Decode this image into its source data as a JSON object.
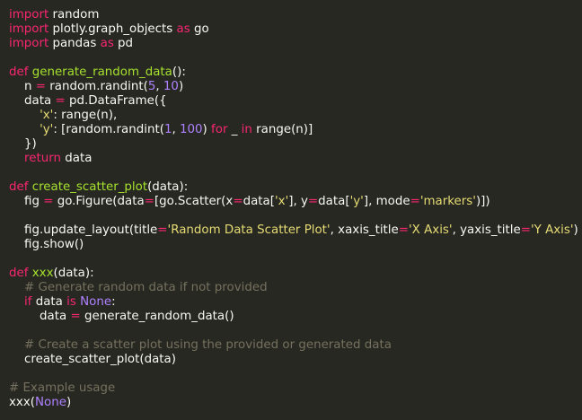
{
  "theme": {
    "background": "#272822",
    "text": "#f8f8f2",
    "keyword": "#f92672",
    "function": "#a6e22e",
    "string": "#e6db74",
    "number": "#ae81ff",
    "comment": "#75715e"
  },
  "code": {
    "lines": [
      [
        {
          "t": "kw",
          "s": "import"
        },
        {
          "t": "txt",
          "s": " random"
        }
      ],
      [
        {
          "t": "kw",
          "s": "import"
        },
        {
          "t": "txt",
          "s": " plotly.graph_objects "
        },
        {
          "t": "kw",
          "s": "as"
        },
        {
          "t": "txt",
          "s": " go"
        }
      ],
      [
        {
          "t": "kw",
          "s": "import"
        },
        {
          "t": "txt",
          "s": " pandas "
        },
        {
          "t": "kw",
          "s": "as"
        },
        {
          "t": "txt",
          "s": " pd"
        }
      ],
      [],
      [
        {
          "t": "kw",
          "s": "def"
        },
        {
          "t": "txt",
          "s": " "
        },
        {
          "t": "fn",
          "s": "generate_random_data"
        },
        {
          "t": "txt",
          "s": "():"
        }
      ],
      [
        {
          "t": "txt",
          "s": "    n "
        },
        {
          "t": "kw",
          "s": "="
        },
        {
          "t": "txt",
          "s": " random.randint("
        },
        {
          "t": "num",
          "s": "5"
        },
        {
          "t": "txt",
          "s": ", "
        },
        {
          "t": "num",
          "s": "10"
        },
        {
          "t": "txt",
          "s": ")"
        }
      ],
      [
        {
          "t": "txt",
          "s": "    data "
        },
        {
          "t": "kw",
          "s": "="
        },
        {
          "t": "txt",
          "s": " pd.DataFrame({"
        }
      ],
      [
        {
          "t": "txt",
          "s": "        "
        },
        {
          "t": "str",
          "s": "'x'"
        },
        {
          "t": "txt",
          "s": ": range(n),"
        }
      ],
      [
        {
          "t": "txt",
          "s": "        "
        },
        {
          "t": "str",
          "s": "'y'"
        },
        {
          "t": "txt",
          "s": ": [random.randint("
        },
        {
          "t": "num",
          "s": "1"
        },
        {
          "t": "txt",
          "s": ", "
        },
        {
          "t": "num",
          "s": "100"
        },
        {
          "t": "txt",
          "s": ") "
        },
        {
          "t": "kw",
          "s": "for"
        },
        {
          "t": "txt",
          "s": " _ "
        },
        {
          "t": "kw",
          "s": "in"
        },
        {
          "t": "txt",
          "s": " range(n)]"
        }
      ],
      [
        {
          "t": "txt",
          "s": "    })"
        }
      ],
      [
        {
          "t": "txt",
          "s": "    "
        },
        {
          "t": "kw",
          "s": "return"
        },
        {
          "t": "txt",
          "s": " data"
        }
      ],
      [],
      [
        {
          "t": "kw",
          "s": "def"
        },
        {
          "t": "txt",
          "s": " "
        },
        {
          "t": "fn",
          "s": "create_scatter_plot"
        },
        {
          "t": "txt",
          "s": "(data):"
        }
      ],
      [
        {
          "t": "txt",
          "s": "    fig "
        },
        {
          "t": "kw",
          "s": "="
        },
        {
          "t": "txt",
          "s": " go.Figure(data"
        },
        {
          "t": "kw",
          "s": "="
        },
        {
          "t": "txt",
          "s": "[go.Scatter(x"
        },
        {
          "t": "kw",
          "s": "="
        },
        {
          "t": "txt",
          "s": "data["
        },
        {
          "t": "str",
          "s": "'x'"
        },
        {
          "t": "txt",
          "s": "], y"
        },
        {
          "t": "kw",
          "s": "="
        },
        {
          "t": "txt",
          "s": "data["
        },
        {
          "t": "str",
          "s": "'y'"
        },
        {
          "t": "txt",
          "s": "], mode"
        },
        {
          "t": "kw",
          "s": "="
        },
        {
          "t": "str",
          "s": "'markers'"
        },
        {
          "t": "txt",
          "s": ")])"
        }
      ],
      [],
      [
        {
          "t": "txt",
          "s": "    fig.update_layout(title"
        },
        {
          "t": "kw",
          "s": "="
        },
        {
          "t": "str",
          "s": "'Random Data Scatter Plot'"
        },
        {
          "t": "txt",
          "s": ", xaxis_title"
        },
        {
          "t": "kw",
          "s": "="
        },
        {
          "t": "str",
          "s": "'X Axis'"
        },
        {
          "t": "txt",
          "s": ", yaxis_title"
        },
        {
          "t": "kw",
          "s": "="
        },
        {
          "t": "str",
          "s": "'Y Axis'"
        },
        {
          "t": "txt",
          "s": ")"
        }
      ],
      [
        {
          "t": "txt",
          "s": "    fig.show()"
        }
      ],
      [],
      [
        {
          "t": "kw",
          "s": "def"
        },
        {
          "t": "txt",
          "s": " "
        },
        {
          "t": "fn",
          "s": "xxx"
        },
        {
          "t": "txt",
          "s": "(data):"
        }
      ],
      [
        {
          "t": "txt",
          "s": "    "
        },
        {
          "t": "cm",
          "s": "# Generate random data if not provided"
        }
      ],
      [
        {
          "t": "txt",
          "s": "    "
        },
        {
          "t": "kw",
          "s": "if"
        },
        {
          "t": "txt",
          "s": " data "
        },
        {
          "t": "kw",
          "s": "is"
        },
        {
          "t": "txt",
          "s": " "
        },
        {
          "t": "num",
          "s": "None"
        },
        {
          "t": "txt",
          "s": ":"
        }
      ],
      [
        {
          "t": "txt",
          "s": "        data "
        },
        {
          "t": "kw",
          "s": "="
        },
        {
          "t": "txt",
          "s": " generate_random_data()"
        }
      ],
      [],
      [
        {
          "t": "txt",
          "s": "    "
        },
        {
          "t": "cm",
          "s": "# Create a scatter plot using the provided or generated data"
        }
      ],
      [
        {
          "t": "txt",
          "s": "    create_scatter_plot(data)"
        }
      ],
      [],
      [
        {
          "t": "cm",
          "s": "# Example usage"
        }
      ],
      [
        {
          "t": "txt",
          "s": "xxx("
        },
        {
          "t": "num",
          "s": "None"
        },
        {
          "t": "txt",
          "s": ")"
        }
      ]
    ]
  }
}
